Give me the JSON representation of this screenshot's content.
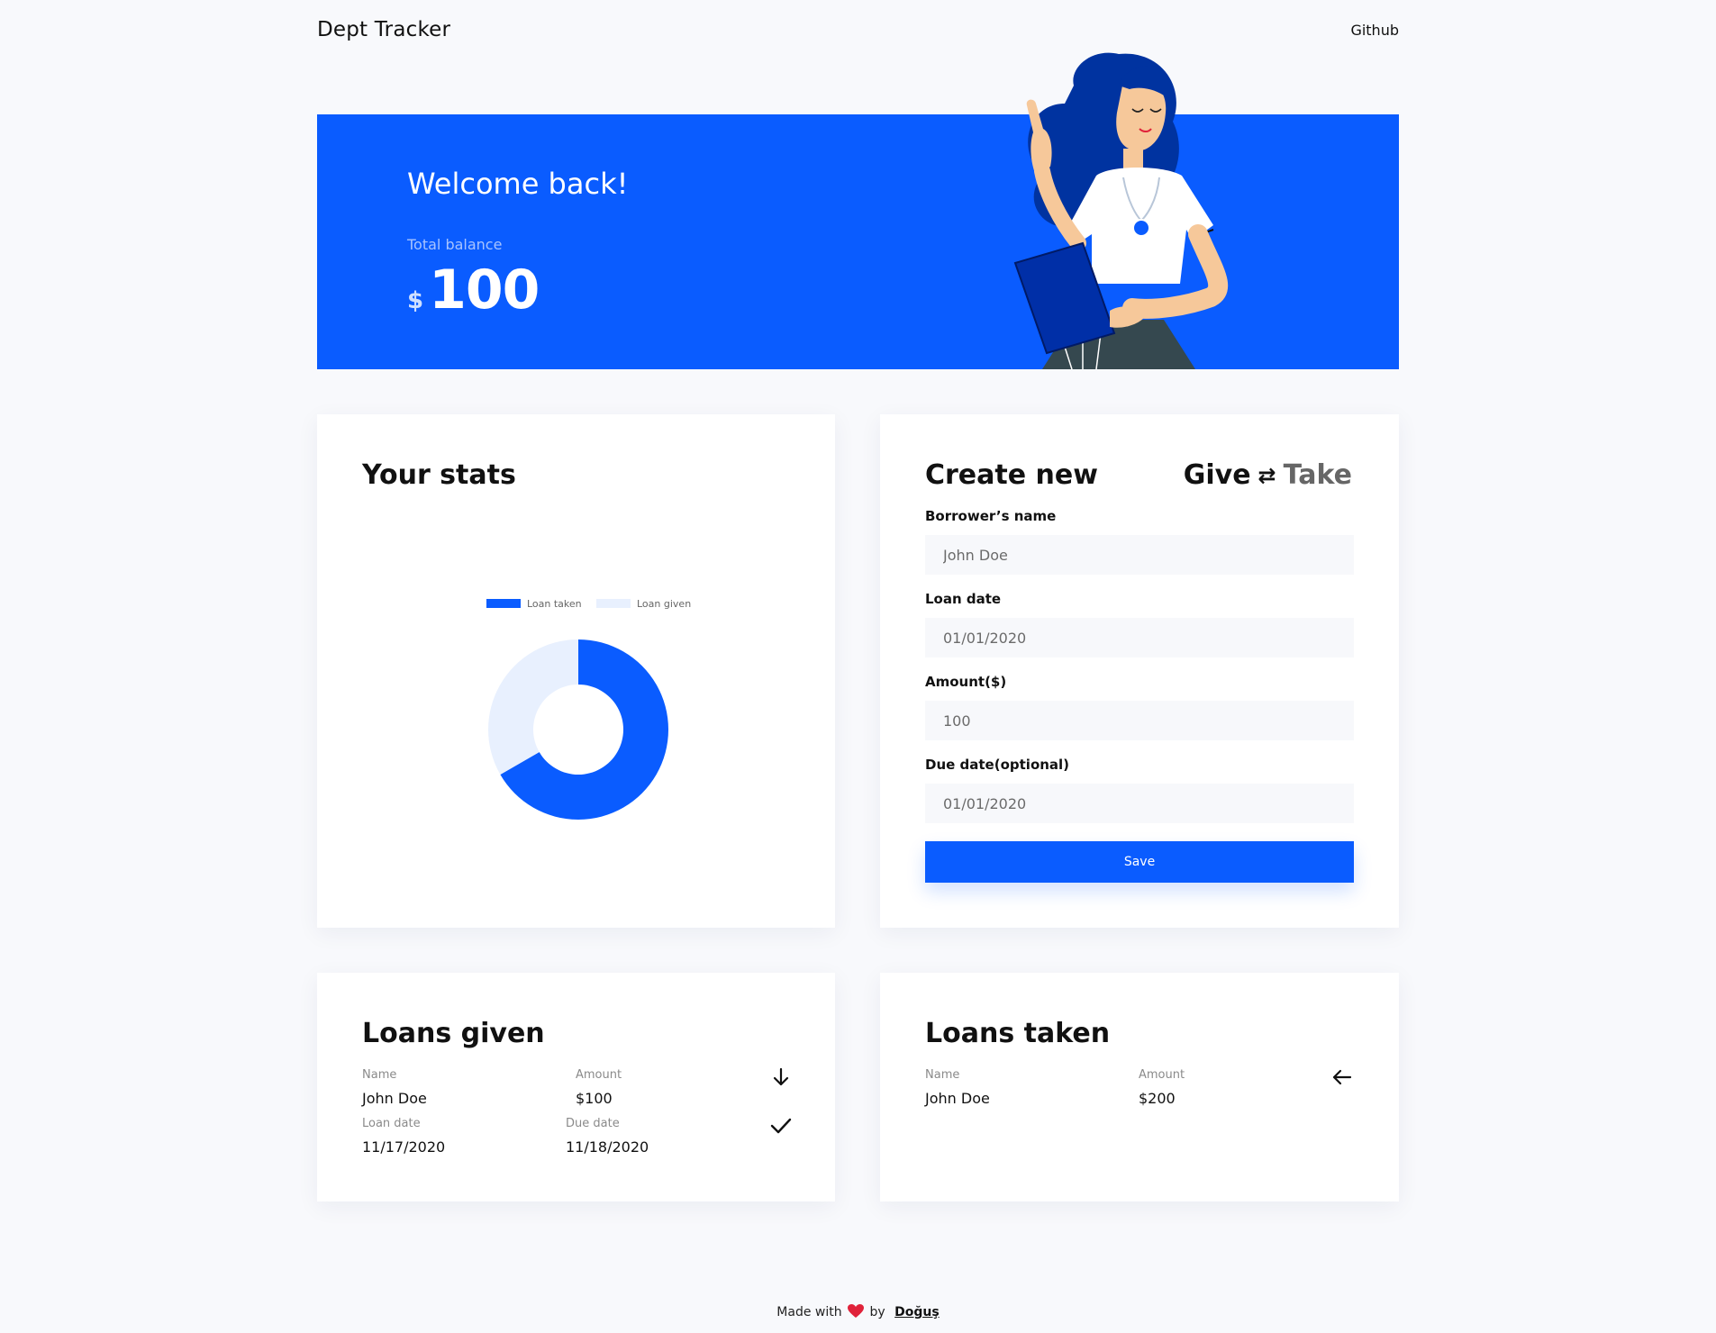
{
  "header": {
    "brand": "Dept Tracker",
    "github_link": "Github"
  },
  "hero": {
    "title": "Welcome back!",
    "balance_label": "Total balance",
    "balance_currency": "$",
    "balance_value": "100",
    "background_color": "#0a5cff"
  },
  "stats": {
    "title": "Your stats",
    "chart_data": {
      "type": "pie",
      "variant": "doughnut",
      "labels": [
        "Loan taken",
        "Loan given"
      ],
      "values": [
        200,
        100
      ],
      "colors": [
        "#0a5cff",
        "#e8f0fe"
      ],
      "legend_position": "top"
    }
  },
  "create": {
    "title": "Create new",
    "toggle": {
      "give": "Give",
      "swap_icon": "swap-arrows-icon",
      "take": "Take"
    },
    "fields": [
      {
        "label": "Borrower’s name",
        "placeholder": "John Doe"
      },
      {
        "label": "Loan date",
        "placeholder": "01/01/2020"
      },
      {
        "label": "Amount($)",
        "placeholder": "100"
      },
      {
        "label": "Due date(optional)",
        "placeholder": "01/01/2020"
      }
    ],
    "save_label": "Save"
  },
  "loans_given": {
    "title": "Loans given",
    "name_label": "Name",
    "amount_label": "Amount",
    "loan_date_label": "Loan date",
    "due_date_label": "Due date",
    "items": [
      {
        "name": "John Doe",
        "amount": "$100",
        "loan_date": "11/17/2020",
        "due_date": "11/18/2020"
      }
    ]
  },
  "loans_taken": {
    "title": "Loans taken",
    "name_label": "Name",
    "amount_label": "Amount",
    "items": [
      {
        "name": "John Doe",
        "amount": "$200"
      }
    ]
  },
  "footer": {
    "made_with": "Made with",
    "by": "by",
    "author": "Doğuş"
  }
}
